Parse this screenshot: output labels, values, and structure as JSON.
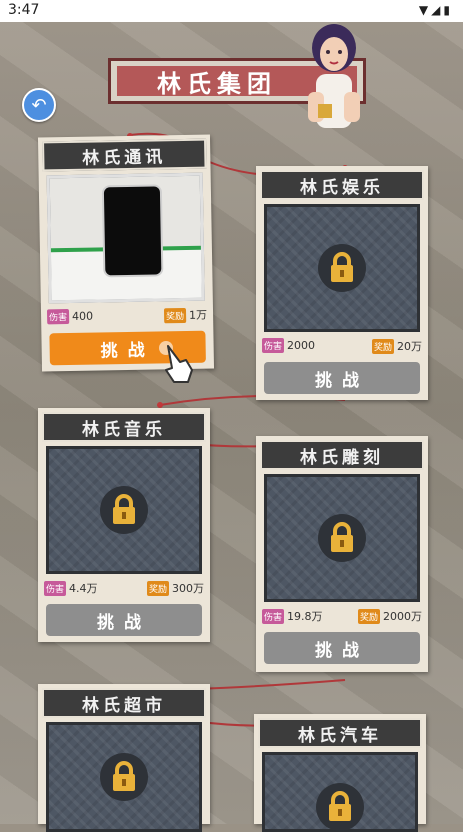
{
  "status": {
    "time": "3:47"
  },
  "header": {
    "title": "林氏集团"
  },
  "badges": {
    "damage": "伤害",
    "reward": "奖励"
  },
  "cards": [
    {
      "name": "林氏通讯",
      "damage": "400",
      "reward": "1万",
      "button": "挑战",
      "unlocked": true
    },
    {
      "name": "林氏娱乐",
      "damage": "2000",
      "reward": "20万",
      "button": "挑战",
      "unlocked": false
    },
    {
      "name": "林氏音乐",
      "damage": "4.4万",
      "reward": "300万",
      "button": "挑战",
      "unlocked": false
    },
    {
      "name": "林氏雕刻",
      "damage": "19.8万",
      "reward": "2000万",
      "button": "挑战",
      "unlocked": false
    },
    {
      "name": "林氏超市",
      "unlocked": false
    },
    {
      "name": "林氏汽车",
      "unlocked": false
    }
  ],
  "colors": {
    "accent_button": "#f08a1a",
    "locked_button": "#8e8e8e",
    "title_banner": "#b45858"
  }
}
